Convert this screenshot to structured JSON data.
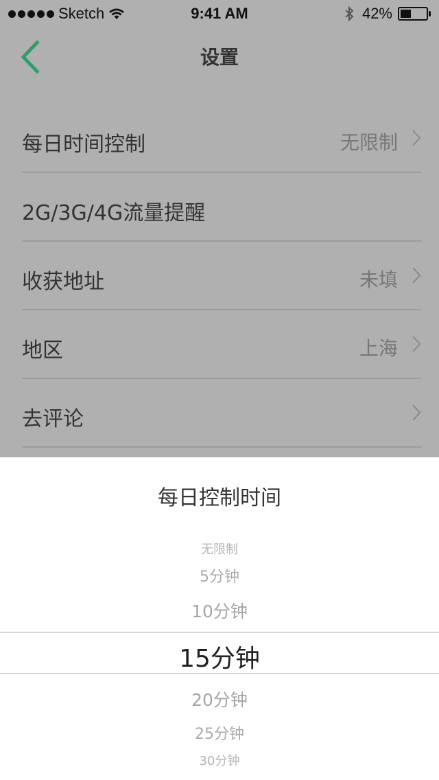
{
  "status_bar": {
    "carrier": "Sketch",
    "time": "9:41 AM",
    "battery_percent": "42%",
    "battery_level": 0.42
  },
  "nav": {
    "title": "设置",
    "accent_color": "#2e9e6b"
  },
  "settings": {
    "items": [
      {
        "label": "每日时间控制",
        "value": "无限制"
      },
      {
        "label": "2G/3G/4G流量提醒",
        "value": ""
      },
      {
        "label": "收获地址",
        "value": "未填"
      },
      {
        "label": "地区",
        "value": "上海"
      },
      {
        "label": "去评论",
        "value": ""
      }
    ]
  },
  "picker": {
    "title": "每日控制时间",
    "options": [
      "无限制",
      "5分钟",
      "10分钟",
      "15分钟",
      "20分钟",
      "25分钟",
      "30分钟"
    ],
    "selected": "15分钟"
  }
}
